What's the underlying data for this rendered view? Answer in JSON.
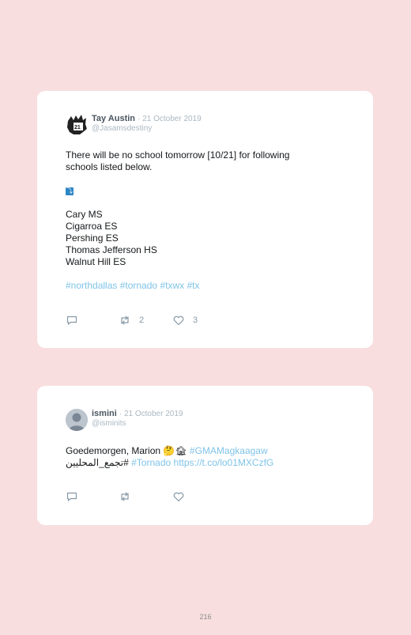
{
  "tweets": [
    {
      "name": "Tay Austin",
      "date": "· 21 October 2019",
      "handle": "@Jasamsdestiny",
      "lines": [
        "There will be no school tomorrow [10/21] for following",
        "schools listed below."
      ],
      "emoji": "⤵",
      "schools": [
        "Cary MS",
        "Cigarroa ES",
        "Pershing ES",
        "Thomas Jefferson HS",
        "Walnut Hill ES"
      ],
      "hashtags": [
        "#northdallas",
        "#tornado",
        "#txwx",
        "#tx"
      ],
      "retweets": "2",
      "likes": "3"
    },
    {
      "name": "ismini",
      "date": "· 21 October 2019",
      "handle": "@isminits",
      "line1_text": "Goedemorgen, Marion 🤔🏚",
      "line1_tag": "#GMAMagkaagaw",
      "line2_tag_rtl": "#تجمع_المحليين",
      "line2_tag": "#Tornado",
      "line2_link": "https://t.co/lo01MXCzfG",
      "retweets": "",
      "likes": ""
    }
  ],
  "page_number": "216"
}
